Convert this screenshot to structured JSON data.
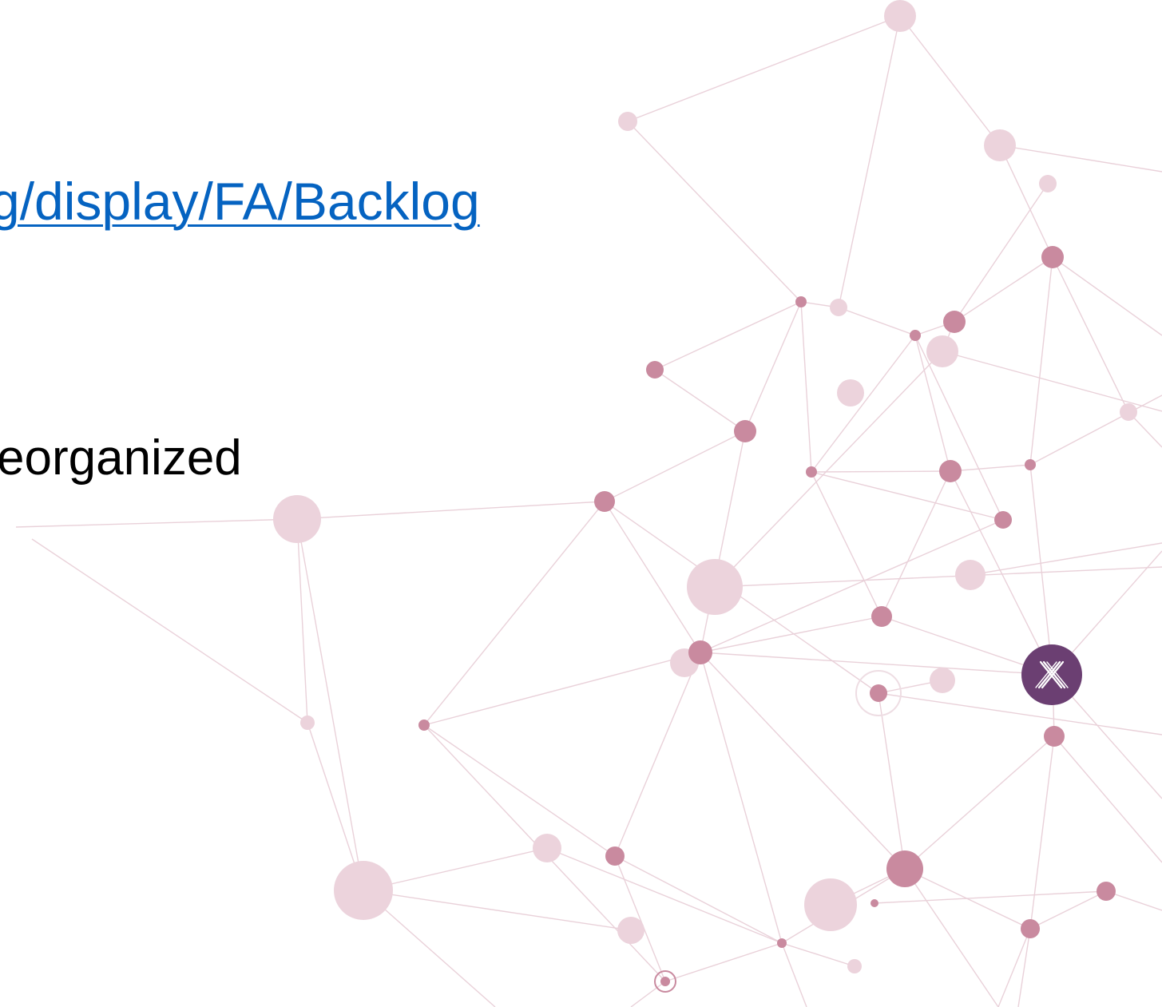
{
  "slide": {
    "link_text": "g/display/FA/Backlog",
    "body_text": "eorganized"
  },
  "decoration": {
    "network_colors": {
      "node_dark": "#c98a9f",
      "node_light": "#ecd3dc",
      "edge": "#e3c2cd"
    },
    "logo": {
      "icon": "x-logo-icon",
      "color": "#6b3f72"
    }
  },
  "colors": {
    "link": "#0563c1",
    "text": "#000000",
    "background": "#ffffff"
  }
}
